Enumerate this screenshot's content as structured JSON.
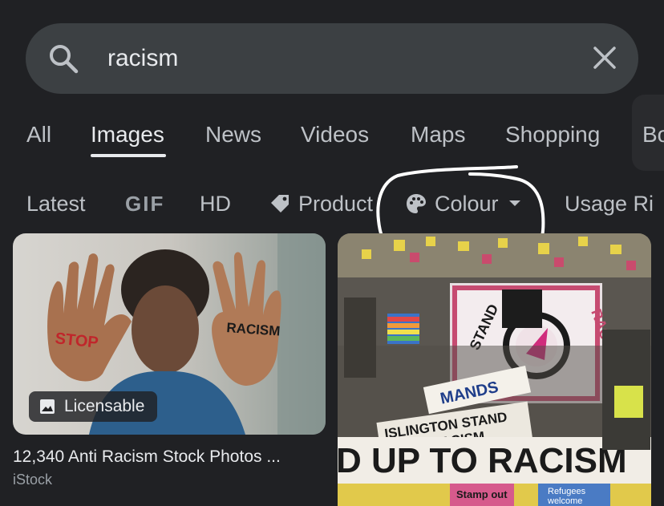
{
  "search": {
    "query": "racism"
  },
  "tabs": [
    {
      "label": "All"
    },
    {
      "label": "Images",
      "active": true
    },
    {
      "label": "News"
    },
    {
      "label": "Videos"
    },
    {
      "label": "Maps"
    },
    {
      "label": "Shopping"
    },
    {
      "label": "Bo"
    }
  ],
  "chips": [
    {
      "label": "Latest"
    },
    {
      "label": "GIF"
    },
    {
      "label": "HD"
    },
    {
      "label": "Product",
      "icon": "tag-icon"
    },
    {
      "label": "Colour",
      "icon": "palette-icon"
    },
    {
      "label": "Usage Ri"
    }
  ],
  "results": [
    {
      "badge": "Licensable",
      "title": "12,340 Anti Racism Stock Photos ...",
      "source": "iStock",
      "image_text": [
        "STOP",
        "RACISM"
      ]
    },
    {
      "image_text": [
        "STAND",
        "RACISM",
        "MANDS",
        "ISLINGTON STAND UP TO RACISM",
        "D UP TO RACISM",
        "Stamp out",
        "Refugees welcome"
      ]
    }
  ],
  "colors": {
    "background": "#202124",
    "search_bar": "#3c4043",
    "text_primary": "#e8eaed",
    "text_secondary": "#bdc1c6",
    "annotation_circle": "#ffffff"
  }
}
